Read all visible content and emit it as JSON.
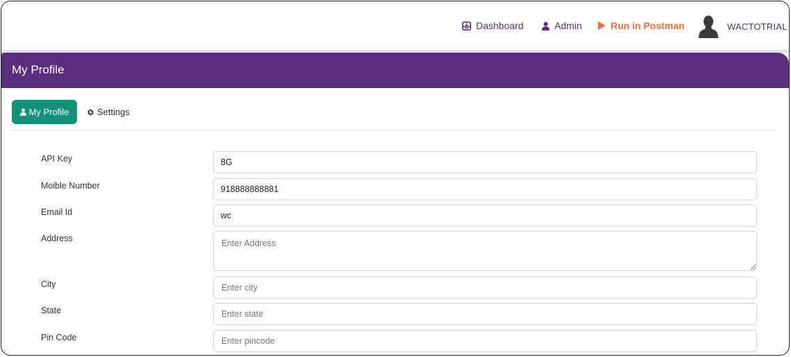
{
  "nav": {
    "dashboard_label": "Dashboard",
    "admin_label": "Admin",
    "postman_label": "Run in Postman",
    "username": "WACTOTRIAL"
  },
  "header": {
    "title": "My Profile"
  },
  "tabs": {
    "profile_label": "My Profile",
    "settings_label": "Settings"
  },
  "form": {
    "api_key": {
      "label": "API Key",
      "value": "8G"
    },
    "mobile": {
      "label": "Moible Number",
      "value": "918888888881"
    },
    "email": {
      "label": "Email Id",
      "value": "wc"
    },
    "address": {
      "label": "Address",
      "placeholder": "Enter Address"
    },
    "city": {
      "label": "City",
      "placeholder": "Enter city"
    },
    "state": {
      "label": "State",
      "placeholder": "Enter state"
    },
    "pincode": {
      "label": "Pin Code",
      "placeholder": "Enter pincode"
    }
  },
  "colors": {
    "brand_purple": "#5a2d7d",
    "postman_orange": "#f26b3a",
    "active_tab_green": "#13917a"
  }
}
